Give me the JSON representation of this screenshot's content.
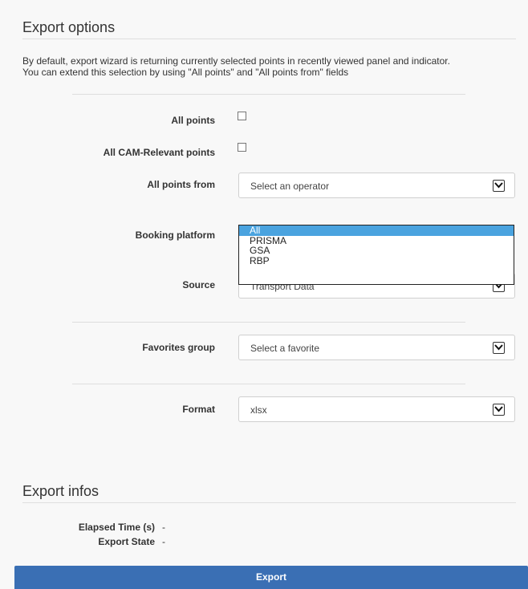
{
  "export_options": {
    "title": "Export options",
    "description_line1": "By default, export wizard is returning currently selected points in recently viewed panel and indicator.",
    "description_line2": "You can extend this selection by using \"All points\" and \"All points from\" fields",
    "all_points": {
      "label": "All points",
      "checked": false
    },
    "all_cam_relevant_points": {
      "label": "All CAM-Relevant points",
      "checked": false
    },
    "all_points_from": {
      "label": "All points from",
      "value": "Select an operator"
    },
    "booking_platform": {
      "label": "Booking platform",
      "options": [
        "All",
        "PRISMA",
        "GSA",
        "RBP"
      ],
      "selected": "All"
    },
    "source": {
      "label": "Source",
      "value": "Transport Data"
    },
    "favorites_group": {
      "label": "Favorites group",
      "value": "Select a favorite"
    },
    "format": {
      "label": "Format",
      "value": "xlsx"
    }
  },
  "export_infos": {
    "title": "Export infos",
    "elapsed_time": {
      "label": "Elapsed Time (s)",
      "value": "-"
    },
    "export_state": {
      "label": "Export State",
      "value": "-"
    }
  },
  "export_button": {
    "label": "Export"
  },
  "colors": {
    "accent": "#3a6fb4",
    "selected_option": "#4aa3df",
    "panel_background": "#f8f8f8"
  }
}
